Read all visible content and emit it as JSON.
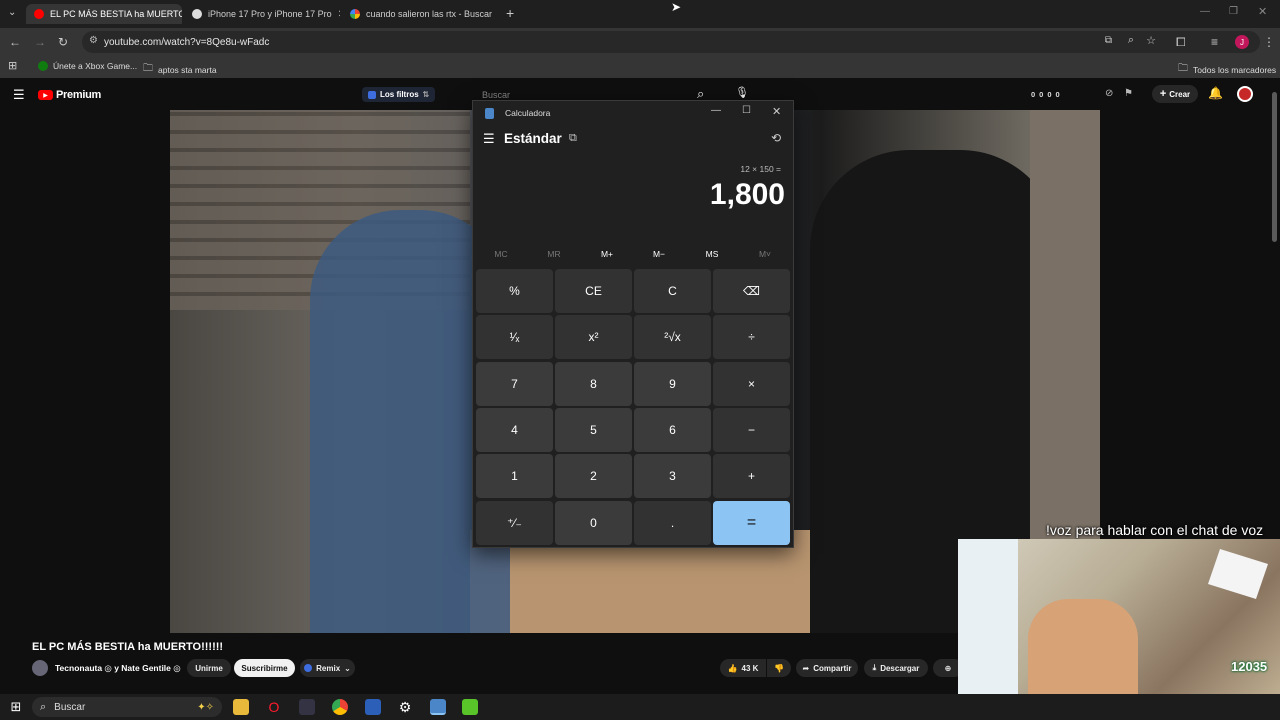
{
  "browser": {
    "tabs": [
      {
        "title": "EL PC MÁS BESTIA ha MUERTO",
        "active": true
      },
      {
        "title": "iPhone 17 Pro y iPhone 17 Pro",
        "active": false
      },
      {
        "title": "cuando salieron las rtx - Buscar",
        "active": false
      }
    ],
    "url": "youtube.com/watch?v=8Qe8u-wFadc",
    "bookmarks": [
      "Únete a Xbox Game...",
      "aptos sta marta"
    ],
    "all_bookmarks": "Todos los marcadores",
    "profile_initial": "J"
  },
  "youtube": {
    "logo": "Premium",
    "search_placeholder": "Buscar",
    "filters": "Los filtros",
    "counters": [
      "0",
      "0",
      "0",
      "0"
    ],
    "create": "Crear",
    "video_title": "EL PC MÁS BESTIA ha MUERTO!!!!!!",
    "channel": "Tecnonauta ◎ y Nate Gentile ◎",
    "join": "Unirme",
    "subscribe": "Suscribirme",
    "remix": "Remix",
    "likes": "43 K",
    "share": "Compartir",
    "download": "Descargar"
  },
  "calculator": {
    "window_title": "Calculadora",
    "mode": "Estándar",
    "expression": "12 × 150 =",
    "display": "1,800",
    "memory": [
      {
        "label": "MC",
        "enabled": false
      },
      {
        "label": "MR",
        "enabled": false
      },
      {
        "label": "M+",
        "enabled": true
      },
      {
        "label": "M−",
        "enabled": true
      },
      {
        "label": "MS",
        "enabled": true
      },
      {
        "label": "M˅",
        "enabled": false
      }
    ],
    "keys": [
      [
        "%",
        "CE",
        "C",
        "⌫"
      ],
      [
        "¹⁄ₓ",
        "x²",
        "²√x",
        "÷"
      ],
      [
        "7",
        "8",
        "9",
        "×"
      ],
      [
        "4",
        "5",
        "6",
        "−"
      ],
      [
        "1",
        "2",
        "3",
        "+"
      ],
      [
        "⁺⁄₋",
        "0",
        ".",
        "="
      ]
    ]
  },
  "stream": {
    "overlay_text": "!voz para hablar con el chat de voz",
    "badge": "12035"
  },
  "taskbar": {
    "search": "Buscar"
  },
  "colors": {
    "accent_blue": "#8cc4f3",
    "youtube_red": "#ff0000"
  }
}
